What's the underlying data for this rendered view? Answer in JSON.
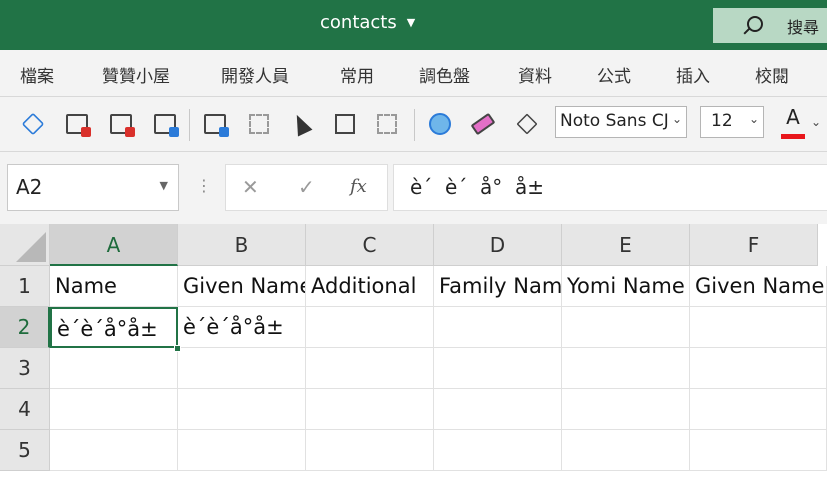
{
  "window": {
    "title": "contacts",
    "search_label": "搜尋"
  },
  "ribbon_tabs": [
    "檔案",
    "贊贊小屋",
    "開發人員",
    "常用",
    "調色盤",
    "資料",
    "公式",
    "插入",
    "校閱"
  ],
  "toolbar": {
    "font_name": "Noto Sans CJ",
    "font_size": "12",
    "font_color_glyph": "A",
    "font_color": "#e8161b"
  },
  "formula_bar": {
    "name_box": "A2",
    "formula": "è´  è´  å°  å±",
    "fx": "fx"
  },
  "grid": {
    "columns": [
      "A",
      "B",
      "C",
      "D",
      "E",
      "F"
    ],
    "rows": [
      "1",
      "2",
      "3",
      "4",
      "5"
    ],
    "header_row": [
      "Name",
      "Given Name",
      "Additional",
      "Family Name",
      "Yomi Name",
      "Given Name"
    ],
    "row2": [
      "è´è´å°å±",
      "è´è´å°å±"
    ]
  },
  "colors": {
    "accent": "#217346"
  }
}
